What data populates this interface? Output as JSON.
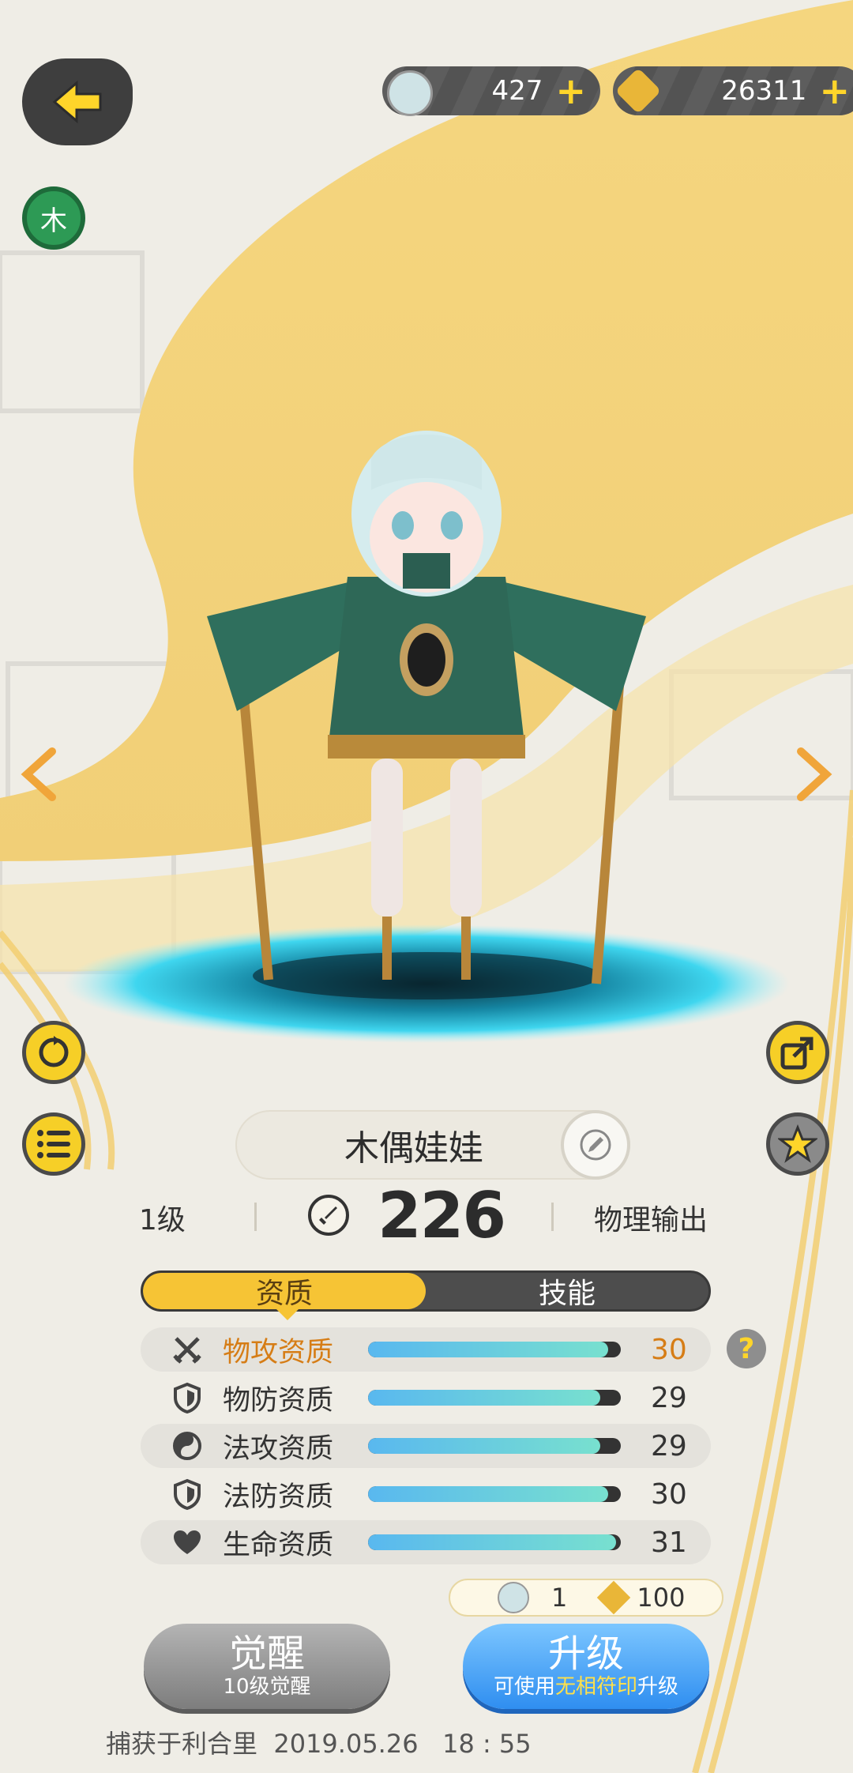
{
  "currencies": [
    {
      "name": "spirit-coin",
      "value": "427",
      "plus": "+"
    },
    {
      "name": "gold-crystal",
      "value": "26311",
      "plus": "+"
    }
  ],
  "element_badge": "木",
  "character": {
    "name": "木偶娃娃",
    "level": "1级",
    "power": "226",
    "role": "物理输出"
  },
  "tabs": [
    {
      "label": "资质",
      "active": true
    },
    {
      "label": "技能",
      "active": false
    }
  ],
  "attributes": [
    {
      "label": "物攻资质",
      "value": "30",
      "fill": 0.95,
      "icon": "swords-icon",
      "highlight": true
    },
    {
      "label": "物防资质",
      "value": "29",
      "fill": 0.92,
      "icon": "shield-icon",
      "highlight": false
    },
    {
      "label": "法攻资质",
      "value": "29",
      "fill": 0.92,
      "icon": "yin-yang-icon",
      "highlight": false
    },
    {
      "label": "法防资质",
      "value": "30",
      "fill": 0.95,
      "icon": "shield-icon",
      "highlight": false
    },
    {
      "label": "生命资质",
      "value": "31",
      "fill": 0.98,
      "icon": "heart-icon",
      "highlight": false
    }
  ],
  "help_label": "?",
  "cost": {
    "item1_count": "1",
    "item2_count": "100"
  },
  "awaken_button": {
    "label": "觉醒",
    "sub": "10级觉醒"
  },
  "upgrade_button": {
    "label": "升级",
    "sub_prefix": "可使用",
    "sub_highlight": "无相符印",
    "sub_suffix": "升级"
  },
  "footer": "捕获于利合里  2019.05.26   18 : 55",
  "colors": {
    "accent_yellow": "#f6c435",
    "upgrade_blue": "#2f8ef0",
    "highlight_orange": "#d67d16"
  }
}
